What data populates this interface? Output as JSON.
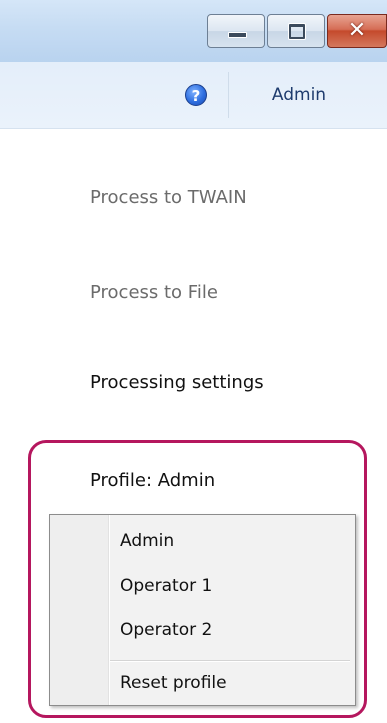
{
  "header": {
    "user_label": "Admin"
  },
  "menu": {
    "process_twain": "Process to TWAIN",
    "process_file": "Process to File",
    "processing_settings": "Processing settings",
    "profile_label": "Profile: Admin"
  },
  "profile_dropdown": {
    "options": [
      "Admin",
      "Operator 1",
      "Operator 2"
    ],
    "reset": "Reset profile"
  },
  "icons": {
    "help": "help-icon",
    "minimize": "minimize-icon",
    "maximize": "maximize-icon",
    "close": "close-icon"
  },
  "colors": {
    "highlight": "#b5175e",
    "disabled_text": "#6b6b6b",
    "header_text": "#1e3b6d"
  }
}
